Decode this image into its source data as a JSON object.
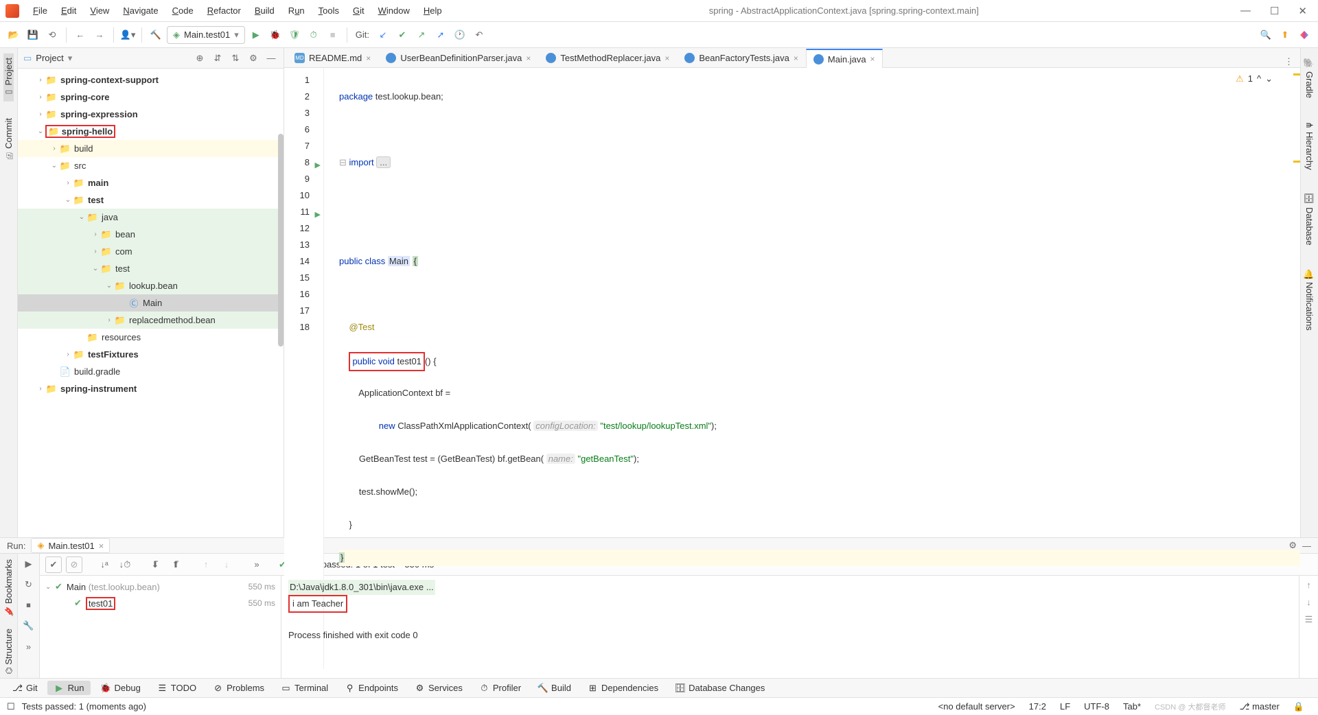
{
  "window": {
    "title": "spring - AbstractApplicationContext.java [spring.spring-context.main]"
  },
  "menu": [
    "File",
    "Edit",
    "View",
    "Navigate",
    "Code",
    "Refactor",
    "Build",
    "Run",
    "Tools",
    "Git",
    "Window",
    "Help"
  ],
  "toolbar": {
    "run_config": "Main.test01",
    "git_label": "Git:"
  },
  "left_strip": [
    "Project",
    "Commit"
  ],
  "right_strip": [
    "Gradle",
    "Hierarchy",
    "Database",
    "Notifications"
  ],
  "project_panel": {
    "title": "Project",
    "items": [
      {
        "indent": 1,
        "arrow": "›",
        "icon": "dir",
        "name": "spring-context-support",
        "bold": true
      },
      {
        "indent": 1,
        "arrow": "›",
        "icon": "dir",
        "name": "spring-core",
        "bold": true
      },
      {
        "indent": 1,
        "arrow": "›",
        "icon": "dir",
        "name": "spring-expression",
        "bold": true
      },
      {
        "indent": 1,
        "arrow": "⌄",
        "icon": "dir",
        "name": "spring-hello",
        "bold": true,
        "redbox": true
      },
      {
        "indent": 2,
        "arrow": "›",
        "icon": "dir-org",
        "name": "build",
        "hl": "hl2"
      },
      {
        "indent": 2,
        "arrow": "⌄",
        "icon": "dir-blue",
        "name": "src"
      },
      {
        "indent": 3,
        "arrow": "›",
        "icon": "dir-blue",
        "name": "main",
        "bold": true
      },
      {
        "indent": 3,
        "arrow": "⌄",
        "icon": "dir-blue",
        "name": "test",
        "bold": true
      },
      {
        "indent": 4,
        "arrow": "⌄",
        "icon": "dir-grn",
        "name": "java",
        "hl": "hl"
      },
      {
        "indent": 5,
        "arrow": "›",
        "icon": "dir",
        "name": "bean",
        "hl": "hl"
      },
      {
        "indent": 5,
        "arrow": "›",
        "icon": "dir",
        "name": "com",
        "hl": "hl"
      },
      {
        "indent": 5,
        "arrow": "⌄",
        "icon": "dir",
        "name": "test",
        "hl": "hl"
      },
      {
        "indent": 6,
        "arrow": "⌄",
        "icon": "dir",
        "name": "lookup.bean",
        "hl": "hl"
      },
      {
        "indent": 7,
        "arrow": "",
        "icon": "file-c",
        "name": "Main",
        "sel": true
      },
      {
        "indent": 6,
        "arrow": "›",
        "icon": "dir",
        "name": "replacedmethod.bean",
        "hl": "hl"
      },
      {
        "indent": 4,
        "arrow": "",
        "icon": "dir-org",
        "name": "resources"
      },
      {
        "indent": 3,
        "arrow": "›",
        "icon": "dir-blue",
        "name": "testFixtures",
        "bold": true
      },
      {
        "indent": 2,
        "arrow": "",
        "icon": "file",
        "name": "build.gradle"
      },
      {
        "indent": 1,
        "arrow": "›",
        "icon": "dir",
        "name": "spring-instrument",
        "bold": true
      }
    ]
  },
  "tabs": [
    {
      "icon": "md",
      "label": "README.md",
      "active": false
    },
    {
      "icon": "java",
      "label": "UserBeanDefinitionParser.java",
      "active": false
    },
    {
      "icon": "java",
      "label": "TestMethodReplacer.java",
      "active": false
    },
    {
      "icon": "java",
      "label": "BeanFactoryTests.java",
      "active": false
    },
    {
      "icon": "java",
      "label": "Main.java",
      "active": true
    }
  ],
  "editor": {
    "warn_count": "1",
    "lines": [
      {
        "n": 1
      },
      {
        "n": 2
      },
      {
        "n": 3
      },
      {
        "n": 6
      },
      {
        "n": 7
      },
      {
        "n": 8
      },
      {
        "n": 9
      },
      {
        "n": 10
      },
      {
        "n": 11
      },
      {
        "n": 12
      },
      {
        "n": 13
      },
      {
        "n": 14
      },
      {
        "n": 15
      },
      {
        "n": 16
      },
      {
        "n": 17
      },
      {
        "n": 18
      }
    ],
    "code": {
      "l1_kw": "package",
      "l1_rest": " test.lookup.bean;",
      "l3_kw": "import",
      "l3_fold": "...",
      "l8_pub": "public class ",
      "l8_name": "Main",
      "l8_brace": "{",
      "l10_ann": "@Test",
      "l11_box": "public void test01",
      "l11_rest": "() {",
      "l12": "ApplicationContext bf =",
      "l13_new": "new",
      "l13_a": " ClassPathXmlApplicationContext(",
      "l13_hint": "configLocation:",
      "l13_str": "\"test/lookup/lookupTest.xml\"",
      "l13_end": ");",
      "l14_a": "GetBeanTest test = (GetBeanTest) bf.getBean(",
      "l14_hint": "name:",
      "l14_str": "\"getBeanTest\"",
      "l14_end": ");",
      "l15": "test.showMe();",
      "l16": "}",
      "l17": "}"
    }
  },
  "run": {
    "label": "Run:",
    "tab": "Main.test01",
    "passed_pre": "✔ Tests passed: 1",
    "passed_post": " of 1 test – 550 ms",
    "tree": [
      {
        "arrow": "⌄",
        "check": true,
        "name": "Main",
        "sub": " (test.lookup.bean)",
        "time": "550 ms"
      },
      {
        "arrow": "",
        "check": true,
        "name": "test01",
        "redbox": true,
        "time": "550 ms",
        "indent": 1
      }
    ],
    "console": {
      "cmd": "D:\\Java\\jdk1.8.0_301\\bin\\java.exe ...",
      "out": "i am Teacher",
      "exit": "Process finished with exit code 0"
    }
  },
  "bottom_tabs": [
    {
      "icon": "git",
      "label": "Git"
    },
    {
      "icon": "run",
      "label": "Run",
      "active": true
    },
    {
      "icon": "debug",
      "label": "Debug"
    },
    {
      "icon": "todo",
      "label": "TODO"
    },
    {
      "icon": "prob",
      "label": "Problems"
    },
    {
      "icon": "term",
      "label": "Terminal"
    },
    {
      "icon": "endp",
      "label": "Endpoints"
    },
    {
      "icon": "serv",
      "label": "Services"
    },
    {
      "icon": "prof",
      "label": "Profiler"
    },
    {
      "icon": "build",
      "label": "Build"
    },
    {
      "icon": "dep",
      "label": "Dependencies"
    },
    {
      "icon": "db",
      "label": "Database Changes"
    }
  ],
  "status": {
    "msg": "Tests passed: 1 (moments ago)",
    "server": "<no default server>",
    "pos": "17:2",
    "lf": "LF",
    "enc": "UTF-8",
    "tab": "Tab*",
    "branch": "master",
    "watermark": "CSDN @ 大都督老师"
  },
  "left_bottom_strip": [
    "Bookmarks",
    "Structure"
  ]
}
